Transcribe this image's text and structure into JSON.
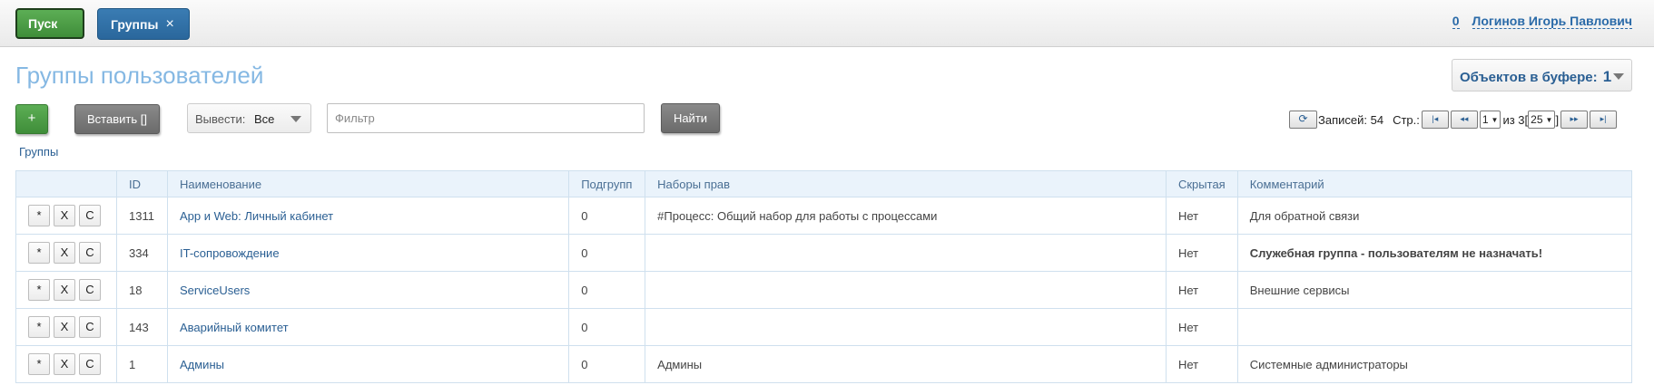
{
  "topbar": {
    "start_label": "Пуск",
    "tab_label": "Группы",
    "tab_close": "×",
    "user_count": "0",
    "user_name": "Логинов Игорь Павлович"
  },
  "page": {
    "title": "Группы пользователей",
    "buffer_label": "Объектов в буфере:",
    "buffer_count": "1"
  },
  "toolbar": {
    "add_label": "+",
    "paste_label": "Вставить []",
    "output_label": "Вывести:",
    "output_value": "Все",
    "filter_placeholder": "Фильтр",
    "find_label": "Найти"
  },
  "pager": {
    "refresh_icon": "⟳",
    "records_text": "Записей: 54",
    "page_label": "Стр.:",
    "first": "|◂",
    "prev": "◂◂",
    "current_page": "1",
    "of_text": "из 3[",
    "page_size": "25",
    "close_bracket": "]",
    "next": "▸▸",
    "last": "▸|"
  },
  "breadcrumb": "Группы",
  "table": {
    "headers": [
      "",
      "ID",
      "Наименование",
      "Подгрупп",
      "Наборы прав",
      "Скрытая",
      "Комментарий"
    ],
    "action_labels": [
      "*",
      "X",
      "C"
    ],
    "rows": [
      {
        "id": "1311",
        "name": "App и Web: Личный кабинет",
        "subgroups": "0",
        "rights": "#Процесс: Общий набор для работы с процессами",
        "hidden": "Нет",
        "comment": "Для обратной связи"
      },
      {
        "id": "334",
        "name": "IT-сопровождение",
        "subgroups": "0",
        "rights": "",
        "hidden": "Нет",
        "comment": "Служебная группа - пользователям не назначать!"
      },
      {
        "id": "18",
        "name": "ServiceUsers",
        "subgroups": "0",
        "rights": "",
        "hidden": "Нет",
        "comment": "Внешние сервисы"
      },
      {
        "id": "143",
        "name": "Аварийный комитет",
        "subgroups": "0",
        "rights": "",
        "hidden": "Нет",
        "comment": ""
      },
      {
        "id": "1",
        "name": "Админы",
        "subgroups": "0",
        "rights": "Админы",
        "hidden": "Нет",
        "comment": "Системные администраторы"
      }
    ]
  }
}
